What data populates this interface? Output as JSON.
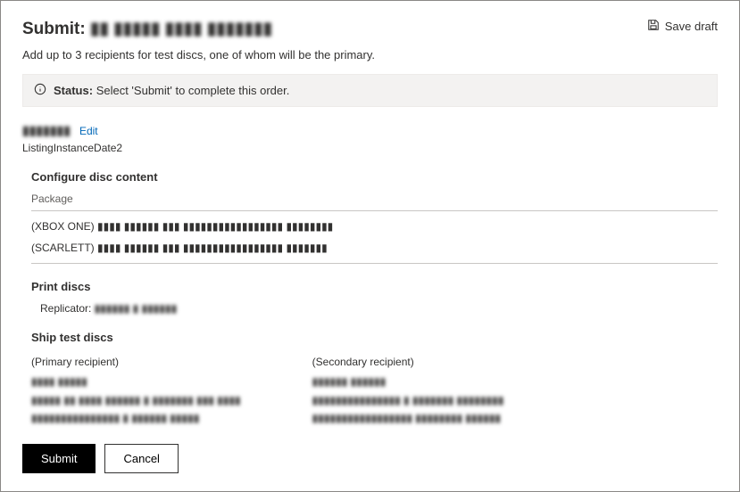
{
  "header": {
    "title_prefix": "Submit: ",
    "title_obscured": "▮▮ ▮▮▮▮▮ ▮▮▮▮ ▮▮▮▮▮▮▮",
    "save_draft": "Save draft"
  },
  "subtitle": "Add up to 3 recipients for test discs, one of whom will be the primary.",
  "status": {
    "label": "Status:",
    "text": "Select 'Submit' to complete this order."
  },
  "listing": {
    "name": "▮▮▮▮▮▮▮",
    "edit": "Edit",
    "date": "ListingInstanceDate2"
  },
  "configure": {
    "title": "Configure disc content",
    "column_header": "Package",
    "packages": [
      "(XBOX ONE) ▮▮▮▮ ▮▮▮▮▮▮ ▮▮▮ ▮▮▮▮▮▮▮▮▮▮▮▮▮▮▮▮▮ ▮▮▮▮▮▮▮▮",
      "(SCARLETT) ▮▮▮▮ ▮▮▮▮▮▮ ▮▮▮ ▮▮▮▮▮▮▮▮▮▮▮▮▮▮▮▮▮ ▮▮▮▮▮▮▮"
    ]
  },
  "print": {
    "title": "Print discs",
    "replicator_label": "Replicator:",
    "replicator_value": "▮▮▮▮▮▮ ▮ ▮▮▮▮▮▮"
  },
  "ship": {
    "title": "Ship test discs",
    "primary": {
      "label": "(Primary recipient)",
      "name": "▮▮▮▮ ▮▮▮▮▮",
      "address": "▮▮▮▮▮ ▮▮ ▮▮▮▮ ▮▮▮▮▮▮ ▮ ▮▮▮▮▮▮▮ ▮▮▮ ▮▮▮▮",
      "contact": "▮▮▮▮▮▮▮▮▮▮▮▮▮▮▮ ▮ ▮▮▮▮▮▮ ▮▮▮▮▮"
    },
    "secondary": {
      "label": "(Secondary recipient)",
      "name": "▮▮▮▮▮▮ ▮▮▮▮▮▮",
      "address": "▮▮▮▮▮▮▮▮▮▮▮▮▮▮▮ ▮ ▮▮▮▮▮▮▮ ▮▮▮▮▮▮▮▮",
      "contact": "▮▮▮▮▮▮▮▮▮▮▮▮▮▮▮▮▮   ▮▮▮▮▮▮▮▮ ▮▮▮▮▮▮"
    }
  },
  "buttons": {
    "submit": "Submit",
    "cancel": "Cancel"
  }
}
